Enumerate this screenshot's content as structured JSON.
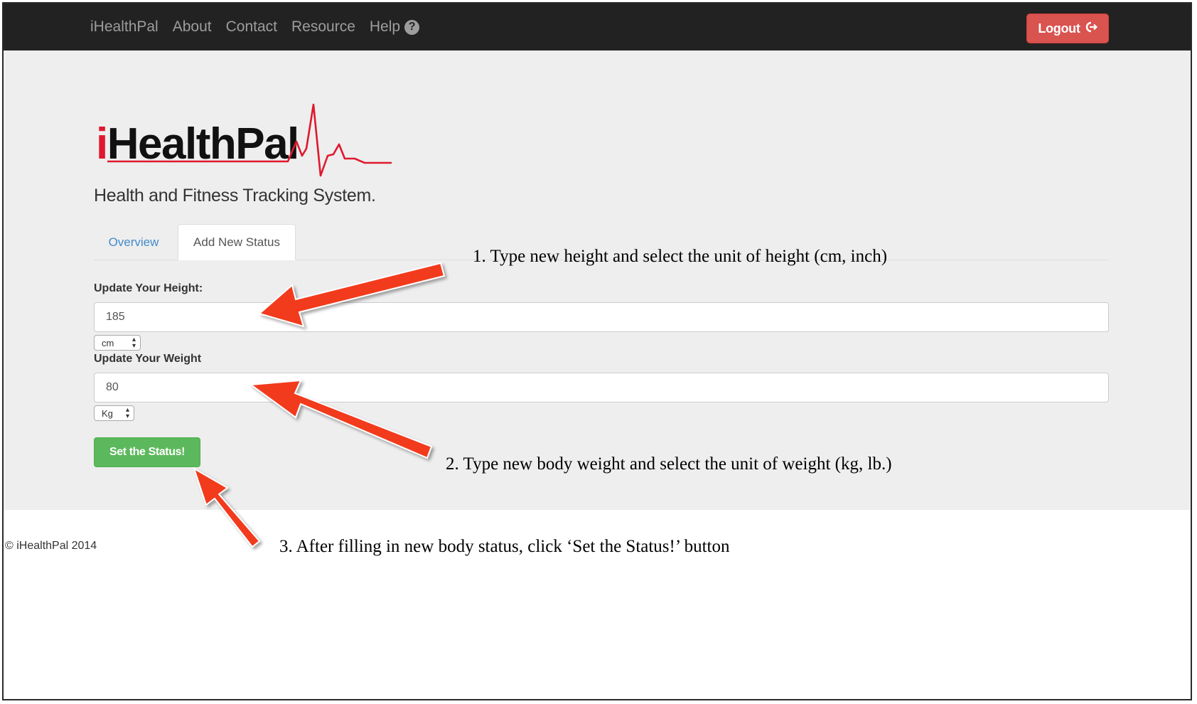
{
  "nav": {
    "brand": "iHealthPal",
    "links": [
      "About",
      "Contact",
      "Resource",
      "Help"
    ],
    "logout_label": "Logout"
  },
  "logo": {
    "prefix": "i",
    "name": "HealthPal"
  },
  "tagline": "Health and Fitness Tracking System.",
  "tabs": [
    {
      "label": "Overview",
      "active": false
    },
    {
      "label": "Add New Status",
      "active": true
    }
  ],
  "form": {
    "height_label": "Update Your Height:",
    "height_value": "185",
    "height_unit": "cm",
    "weight_label": "Update Your Weight",
    "weight_value": "80",
    "weight_unit": "Kg",
    "submit_label": "Set the Status!"
  },
  "footer": "© iHealthPal 2014",
  "annotations": [
    "1. Type new height and select the unit of height (cm, inch)",
    "2. Type new body weight and select the unit of weight (kg, lb.)",
    "3. After filling in new body status, click ‘Set the Status!’ button"
  ],
  "colors": {
    "navbar": "#222222",
    "logout": "#d9534f",
    "submit": "#5cb85c",
    "logo_accent": "#e0182d",
    "arrow": "#f23a1e"
  }
}
